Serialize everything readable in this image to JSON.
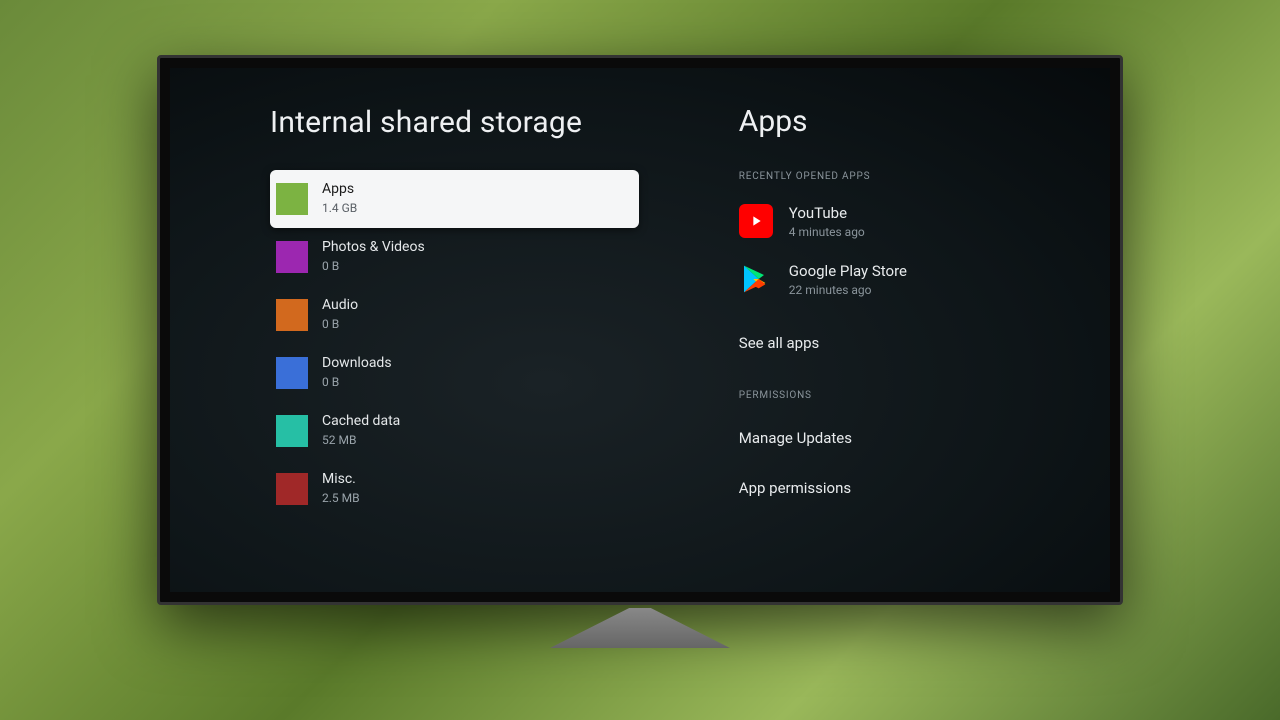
{
  "left": {
    "title": "Internal shared storage",
    "rows": [
      {
        "label": "Apps",
        "size": "1.4 GB",
        "color": "#7cb342",
        "selected": true
      },
      {
        "label": "Photos & Videos",
        "size": "0 B",
        "color": "#9c27b0",
        "selected": false
      },
      {
        "label": "Audio",
        "size": "0 B",
        "color": "#d2691e",
        "selected": false
      },
      {
        "label": "Downloads",
        "size": "0 B",
        "color": "#3a6fd8",
        "selected": false
      },
      {
        "label": "Cached data",
        "size": "52 MB",
        "color": "#26bfa5",
        "selected": false
      },
      {
        "label": "Misc.",
        "size": "2.5 MB",
        "color": "#a02828",
        "selected": false
      }
    ]
  },
  "right": {
    "title": "Apps",
    "recent_header": "RECENTLY OPENED APPS",
    "recent": [
      {
        "label": "YouTube",
        "sub": "4 minutes ago",
        "icon": "youtube"
      },
      {
        "label": "Google Play Store",
        "sub": "22 minutes ago",
        "icon": "playstore"
      }
    ],
    "see_all": "See all apps",
    "permissions_header": "PERMISSIONS",
    "manage_updates": "Manage Updates",
    "app_permissions": "App permissions"
  }
}
